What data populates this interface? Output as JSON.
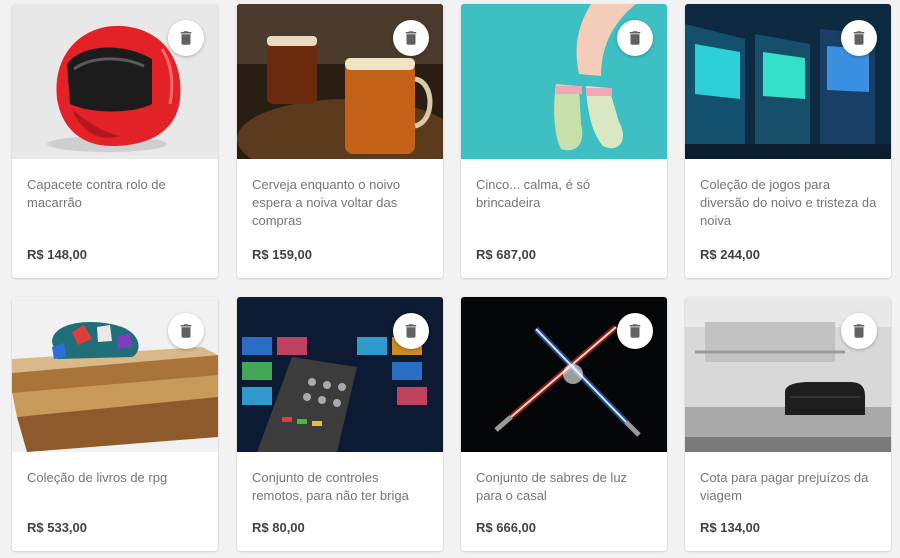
{
  "products": [
    {
      "title": "Capacete contra rolo de macarrão",
      "price": "R$ 148,00",
      "image": "red-helmet"
    },
    {
      "title": "Cerveja enquanto o noivo espera a noiva voltar das compras",
      "price": "R$ 159,00",
      "image": "beer-glasses"
    },
    {
      "title": "Cinco... calma, é só brincadeira",
      "price": "R$ 687,00",
      "image": "baby-booties"
    },
    {
      "title": "Coleção de jogos para diversão do noivo e tristeza da noiva",
      "price": "R$ 244,00",
      "image": "arcade-machines"
    },
    {
      "title": "Coleção de livros de rpg",
      "price": "R$ 533,00",
      "image": "rpg-books-dice"
    },
    {
      "title": "Conjunto de controles remotos, para não ter briga",
      "price": "R$ 80,00",
      "image": "tv-remote"
    },
    {
      "title": "Conjunto de sabres de luz para o casal",
      "price": "R$ 666,00",
      "image": "lightsabers"
    },
    {
      "title": "Cota para pagar prejuízos da viagem",
      "price": "R$ 134,00",
      "image": "luggage-on-belt"
    }
  ],
  "delete_icon": "trash-icon",
  "colors": {
    "card": "#ffffff",
    "background": "#f2f2f2",
    "title": "#757575",
    "price": "#424242",
    "icon": "#616161"
  }
}
